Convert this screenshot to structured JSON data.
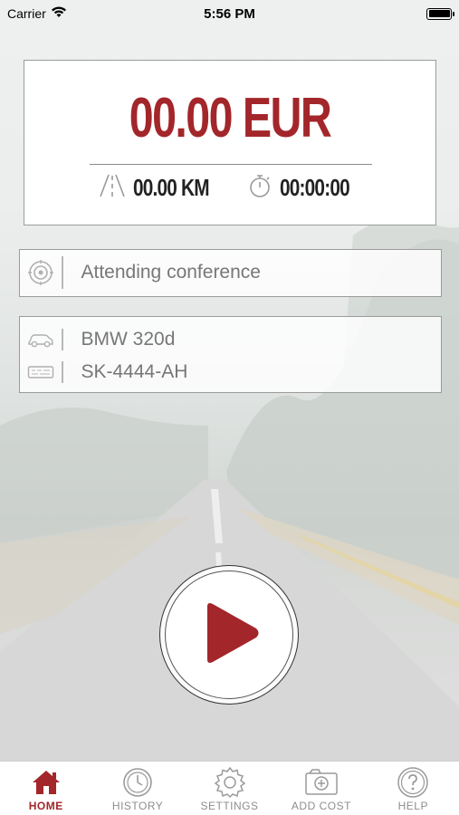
{
  "status_bar": {
    "carrier": "Carrier",
    "time": "5:56 PM"
  },
  "meter": {
    "amount": "00.00 EUR",
    "distance": "00.00 KM",
    "duration": "00:00:00"
  },
  "purpose": {
    "text": "Attending conference"
  },
  "vehicle": {
    "model": "BMW 320d",
    "plate": "SK-4444-AH"
  },
  "tabs": [
    {
      "label": "HOME",
      "icon": "home-icon",
      "active": true
    },
    {
      "label": "HISTORY",
      "icon": "history-icon",
      "active": false
    },
    {
      "label": "SETTINGS",
      "icon": "gear-icon",
      "active": false
    },
    {
      "label": "ADD COST",
      "icon": "add-cost-icon",
      "active": false
    },
    {
      "label": "HELP",
      "icon": "help-icon",
      "active": false
    }
  ],
  "colors": {
    "accent": "#a3262a",
    "border": "#9b9b9b",
    "muted_text": "#777777"
  }
}
